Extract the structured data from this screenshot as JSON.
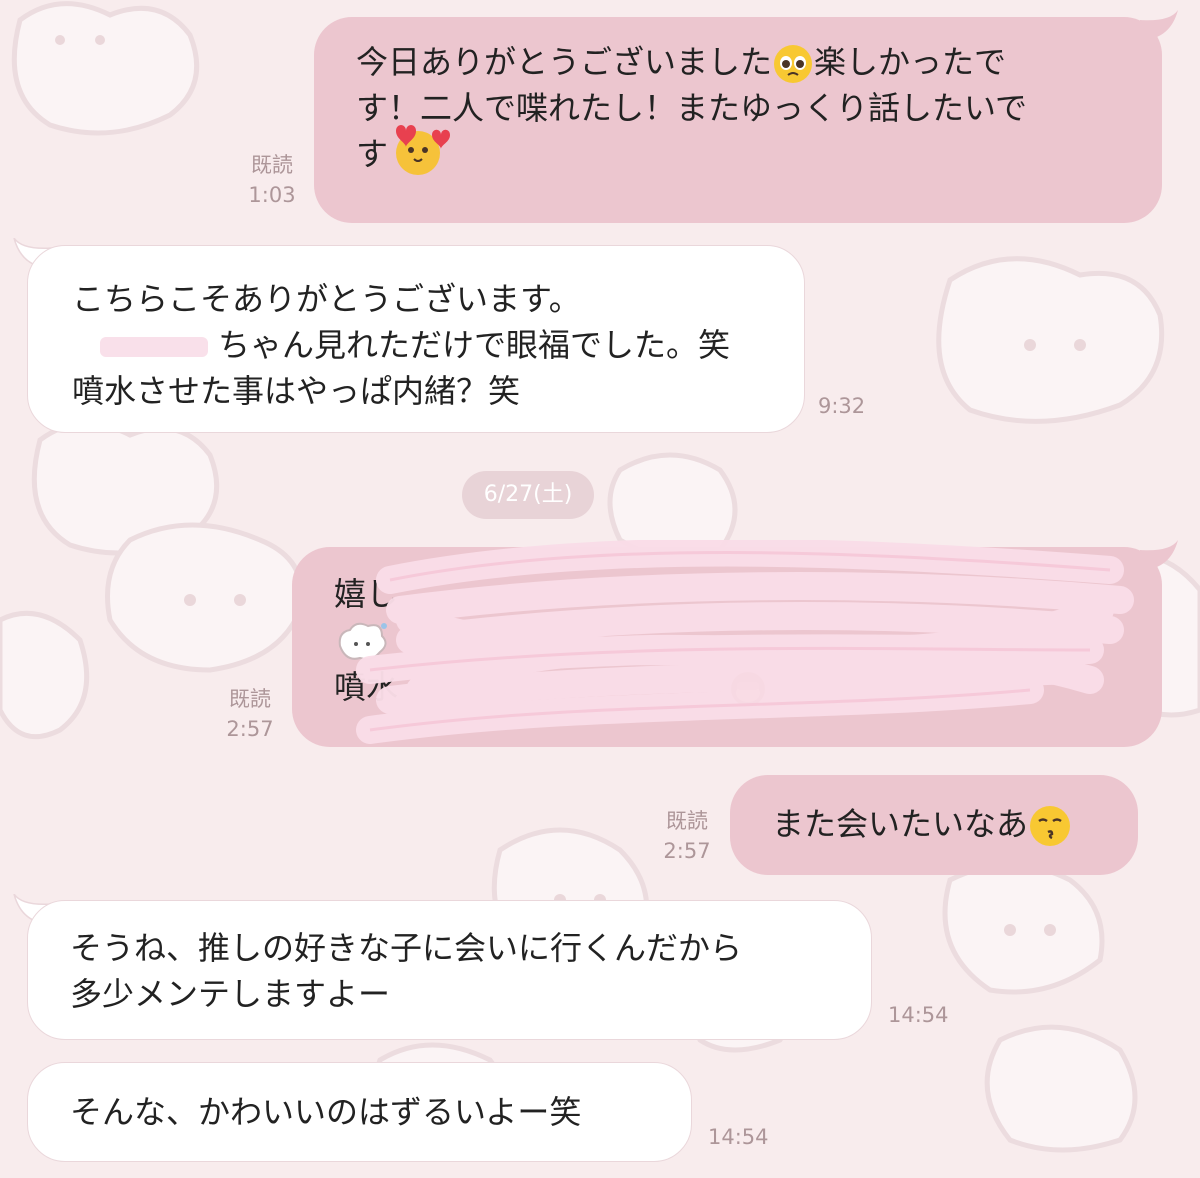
{
  "messages": [
    {
      "id": "m1",
      "side": "sent",
      "lines": [
        "今日ありがとうございました",
        "楽しかったで",
        "す！二人で喋れたし！またゆっくり話したいで",
        "す"
      ],
      "read_label": "既読",
      "time": "1:03"
    },
    {
      "id": "m2",
      "side": "received",
      "lines": [
        "こちらこそありがとうございます。",
        "ちゃん見れただけで眼福でした。笑",
        "噴水させた事はやっぱ内緒？笑"
      ],
      "time": "9:32"
    },
    {
      "id": "date",
      "label": "6/27(土)"
    },
    {
      "id": "m3",
      "side": "sent",
      "lines_visible": [
        "嬉し",
        "噴水"
      ],
      "read_label": "既読",
      "time": "2:57"
    },
    {
      "id": "m4",
      "side": "sent",
      "text": "また会いたいなあ",
      "read_label": "既読",
      "time": "2:57"
    },
    {
      "id": "m5",
      "side": "received",
      "lines": [
        "そうね、推しの好きな子に会いに行くんだから",
        "多少メンテしますよー"
      ],
      "time": "14:54"
    },
    {
      "id": "m6",
      "side": "received",
      "text": "そんな、かわいいのはずるいよー笑",
      "time": "14:54"
    }
  ],
  "icons": {
    "pleading_emoji": "pleading-face-icon",
    "hearts_sticker": "hearts-character-icon",
    "kissing_emoji": "kissing-face-icon",
    "monkey_emoji": "see-no-evil-monkey-icon",
    "sheep_sticker": "fluffy-sheep-icon"
  },
  "colors": {
    "background": "#f8eced",
    "sent_bubble": "#ecc6cf",
    "received_bubble": "#ffffff",
    "meta_text": "#ad9699",
    "redaction": "#f9e0ea"
  }
}
